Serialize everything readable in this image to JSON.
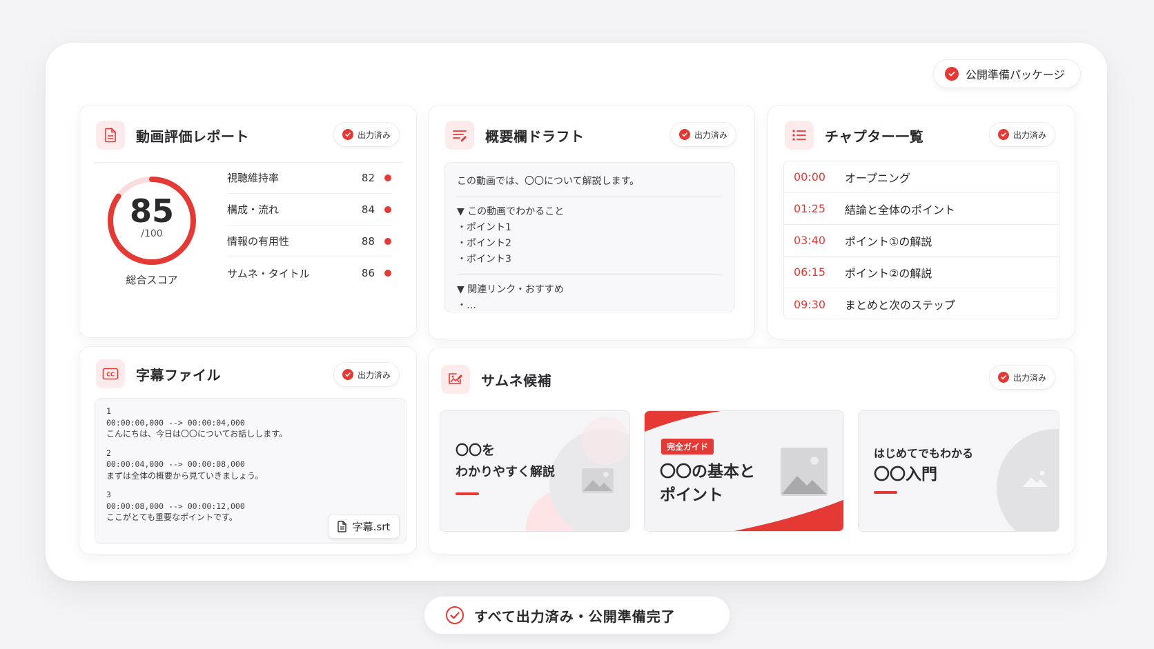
{
  "header": {
    "package_badge": "公開準備パッケージ"
  },
  "output_label": "出力済み",
  "colors": {
    "accent": "#e53935",
    "accent_light": "#fdeaea"
  },
  "report": {
    "title": "動画評価レポート",
    "score": "85",
    "score_max": "/100",
    "score_fraction": 0.85,
    "score_label": "総合スコア",
    "metrics": [
      {
        "label": "視聴維持率",
        "value": "82"
      },
      {
        "label": "構成・流れ",
        "value": "84"
      },
      {
        "label": "情報の有用性",
        "value": "88"
      },
      {
        "label": "サムネ・タイトル",
        "value": "86"
      }
    ]
  },
  "description": {
    "title": "概要欄ドラフト",
    "intro": "この動画では、〇〇について解説します。",
    "section1_heading": "▼ この動画でわかること",
    "points": [
      "・ポイント1",
      "・ポイント2",
      "・ポイント3"
    ],
    "section2_heading": "▼ 関連リンク・おすすめ",
    "section2_item": "・…"
  },
  "chapters": {
    "title": "チャプター一覧",
    "items": [
      {
        "time": "00:00",
        "name": "オープニング"
      },
      {
        "time": "01:25",
        "name": "結論と全体のポイント"
      },
      {
        "time": "03:40",
        "name": "ポイント①の解説"
      },
      {
        "time": "06:15",
        "name": "ポイント②の解説"
      },
      {
        "time": "09:30",
        "name": "まとめと次のステップ"
      }
    ]
  },
  "subtitles": {
    "title": "字幕ファイル",
    "entries": [
      {
        "index": "1",
        "timing": "00:00:00,000 --> 00:00:04,000",
        "text": "こんにちは、今日は〇〇についてお話しします。"
      },
      {
        "index": "2",
        "timing": "00:00:04,000 --> 00:00:08,000",
        "text": "まずは全体の概要から見ていきましょう。"
      },
      {
        "index": "3",
        "timing": "00:00:08,000 --> 00:00:12,000",
        "text": "ここがとても重要なポイントです。"
      }
    ],
    "file_name": "字幕.srt"
  },
  "thumbnails": {
    "title": "サムネ候補",
    "candidates": [
      {
        "line1": "〇〇を",
        "line2": "わかりやすく解説"
      },
      {
        "tag": "完全ガイド",
        "line1": "〇〇の基本と",
        "line2": "ポイント"
      },
      {
        "line1": "はじめてでもわかる",
        "line2": "〇〇入門"
      }
    ]
  },
  "footer": {
    "status": "すべて出力済み・公開準備完了"
  }
}
